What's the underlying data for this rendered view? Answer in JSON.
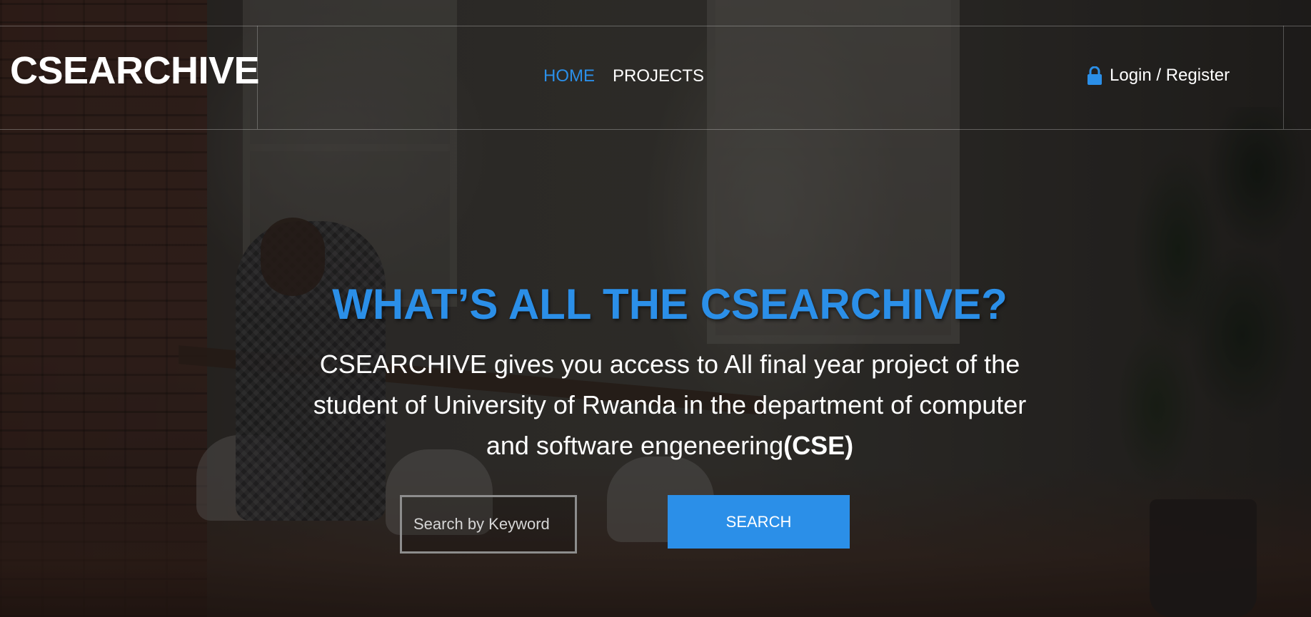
{
  "header": {
    "brand": "CSEARCHIVE",
    "nav": [
      {
        "label": "HOME",
        "active": true
      },
      {
        "label": "PROJECTS",
        "active": false
      }
    ],
    "login": {
      "label": "Login / Register",
      "icon": "lock-icon"
    }
  },
  "hero": {
    "title": "WHAT’S ALL THE CSEARCHIVE?",
    "description": "CSEARCHIVE gives you access to All final year project of the student of University of Rwanda in the department of computer and software engeneering",
    "description_emphasis": "(CSE)"
  },
  "search": {
    "placeholder": "Search by Keyword",
    "value": "",
    "button_label": "SEARCH"
  },
  "colors": {
    "accent": "#2b8fe8",
    "text": "#ffffff"
  }
}
